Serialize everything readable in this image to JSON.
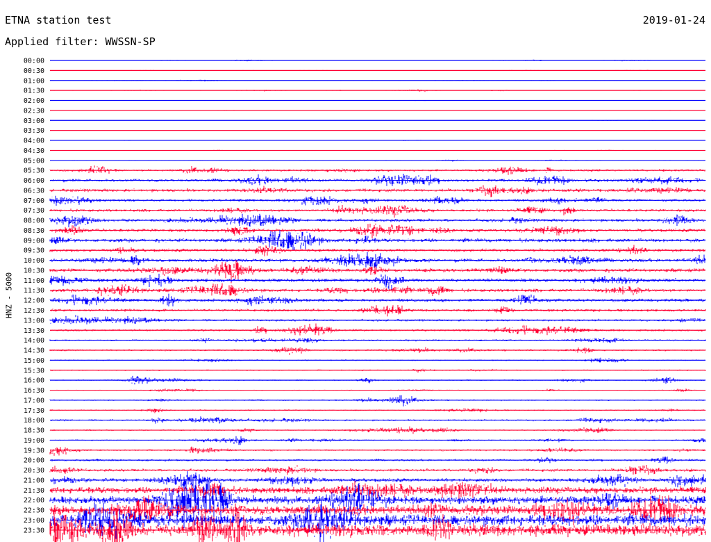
{
  "header": {
    "title": "ETNA station test",
    "date": "2019-01-24",
    "filter": "Applied filter: WWSSN-SP"
  },
  "colors": {
    "even_hour": "#0000ff",
    "half_hour": "#ff0033",
    "background": "#ffffff"
  },
  "chart_data": {
    "type": "line",
    "title": "ETNA station test",
    "ylabel": "HNZ - 5000",
    "grid": false,
    "ticks": [
      "00:00",
      "00:30",
      "01:00",
      "01:30",
      "02:00",
      "02:30",
      "03:00",
      "03:30",
      "04:00",
      "04:30",
      "05:00",
      "05:30",
      "06:00",
      "06:30",
      "07:00",
      "07:30",
      "08:00",
      "08:30",
      "09:00",
      "09:30",
      "10:00",
      "10:30",
      "11:00",
      "11:30",
      "12:00",
      "12:30",
      "13:00",
      "13:30",
      "14:00",
      "14:30",
      "15:00",
      "15:30",
      "16:00",
      "16:30",
      "17:00",
      "17:30",
      "18:00",
      "18:30",
      "19:00",
      "19:30",
      "20:00",
      "20:30",
      "21:00",
      "21:30",
      "22:00",
      "22:30",
      "23:00",
      "23:30"
    ],
    "amplitude": [
      0.5,
      0.4,
      0.5,
      0.6,
      0.3,
      0.3,
      0.3,
      0.3,
      0.3,
      0.3,
      0.6,
      2.5,
      3.5,
      3.5,
      3,
      3,
      3.5,
      3.5,
      4,
      3.5,
      4,
      4,
      4,
      3.5,
      3.5,
      3,
      2.5,
      2.5,
      2,
      2,
      1.5,
      1.5,
      1.5,
      1,
      1.5,
      1.5,
      2,
      1.5,
      1.5,
      2,
      2.5,
      3,
      4,
      7,
      9,
      11,
      12,
      13
    ]
  }
}
